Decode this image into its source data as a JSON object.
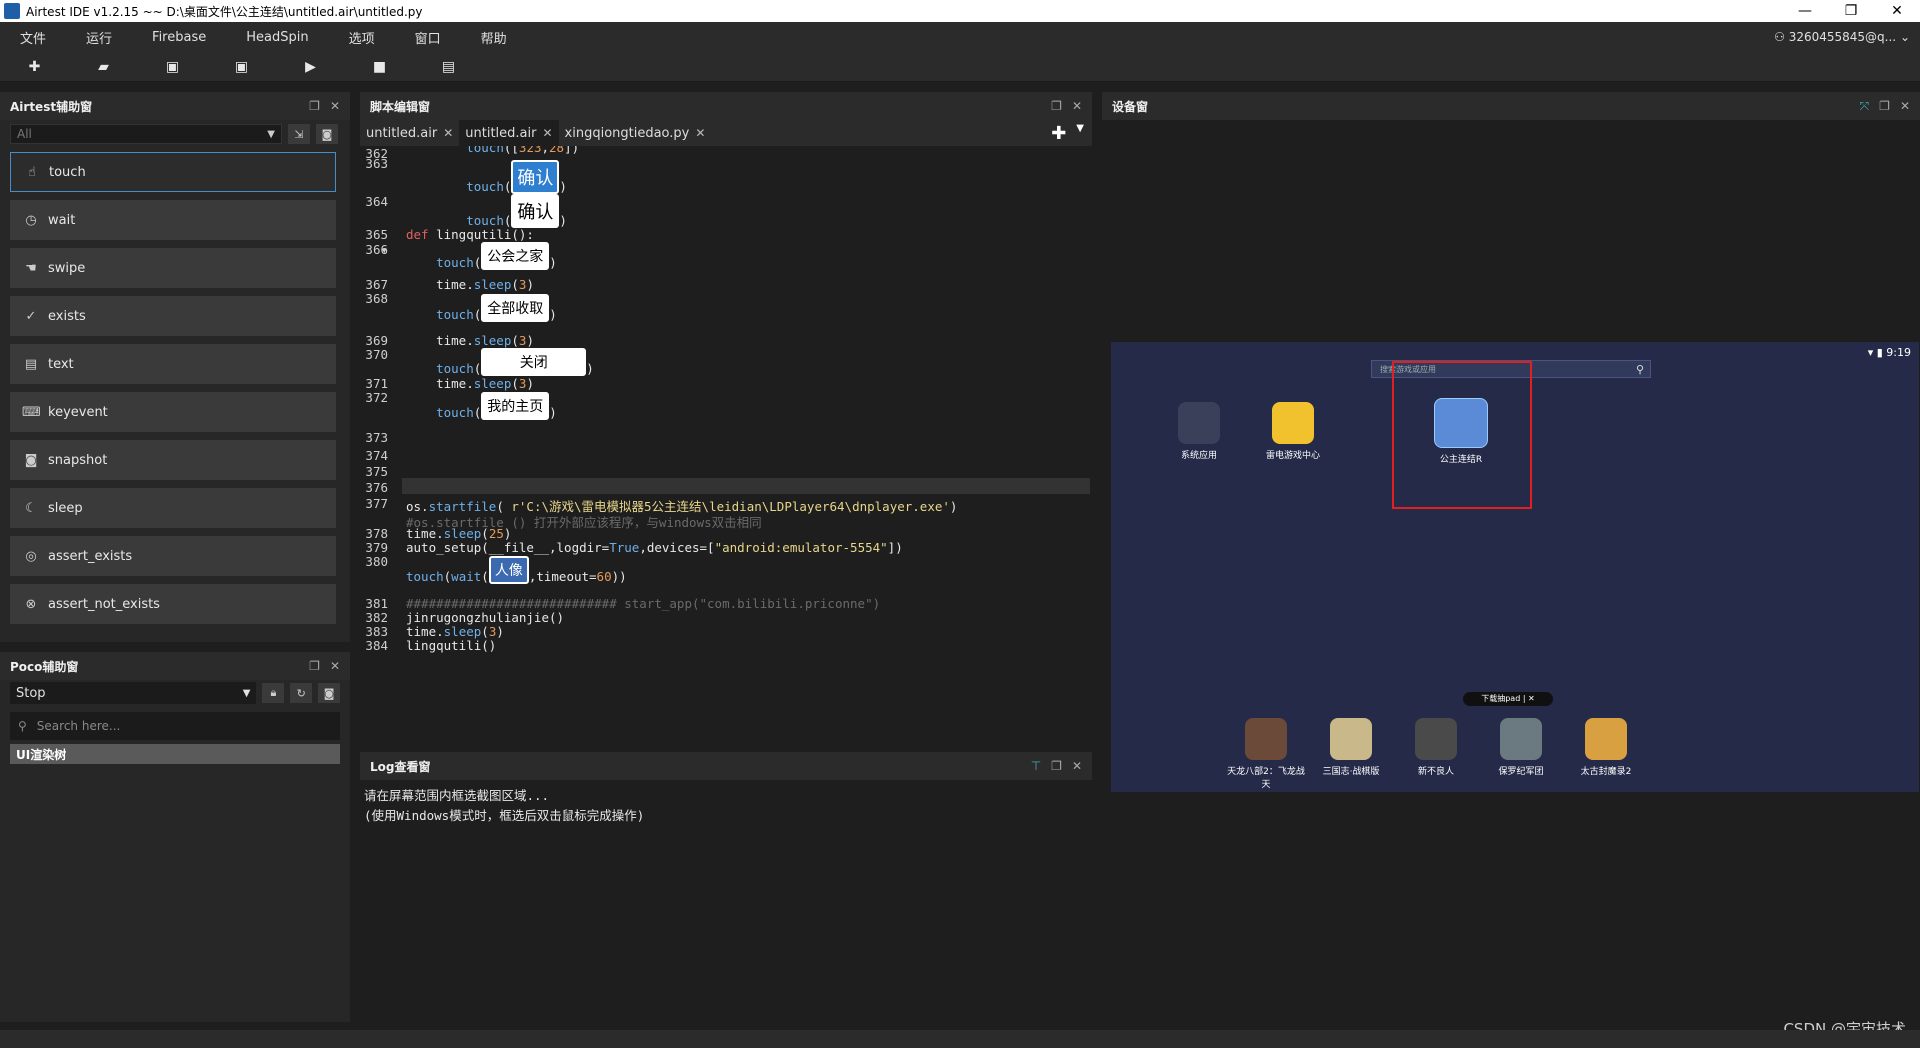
{
  "window": {
    "title": "Airtest IDE v1.2.15 ~~ D:\\桌面文件\\公主连结\\untitled.air\\untitled.py"
  },
  "menu": [
    "文件",
    "运行",
    "Firebase",
    "HeadSpin",
    "选项",
    "窗口",
    "帮助"
  ],
  "account": "3260455845@q...",
  "toolbar_icons": [
    "plus-icon",
    "folder-icon",
    "save-icon",
    "save-as-icon",
    "play-icon",
    "stop-icon",
    "log-icon"
  ],
  "airtest_panel": {
    "title": "Airtest辅助窗",
    "filter": "All",
    "items": [
      {
        "label": "touch",
        "icon": "☝"
      },
      {
        "label": "wait",
        "icon": "◷"
      },
      {
        "label": "swipe",
        "icon": "☚"
      },
      {
        "label": "exists",
        "icon": "✓"
      },
      {
        "label": "text",
        "icon": "▤"
      },
      {
        "label": "keyevent",
        "icon": "⌨"
      },
      {
        "label": "snapshot",
        "icon": "◙"
      },
      {
        "label": "sleep",
        "icon": "☾"
      },
      {
        "label": "assert_exists",
        "icon": "◎"
      },
      {
        "label": "assert_not_exists",
        "icon": "⊗"
      }
    ]
  },
  "poco_panel": {
    "title": "Poco辅助窗",
    "mode": "Stop",
    "search_placeholder": "Search here...",
    "tree_label": "UI渲染树"
  },
  "editor": {
    "title": "脚本编辑窗",
    "tabs": [
      {
        "label": "untitled.air",
        "active": false
      },
      {
        "label": "untitled.air",
        "active": true
      },
      {
        "label": "xingqiongtiedao.py",
        "active": false
      }
    ]
  },
  "log_panel": {
    "title": "Log查看窗",
    "lines": [
      "请在屏幕范围内框选截图区域...",
      "(使用Windows模式时，框选后双击鼠标完成操作)"
    ]
  },
  "device_panel": {
    "title": "设备窗",
    "time": "9:19",
    "search_placeholder": "搜索游戏或应用",
    "apps_top": [
      "系统应用",
      "雷电游戏中心",
      "公主连结R"
    ],
    "pad_chip": "下载抽pad  |  ✕",
    "apps_bottom": [
      "天龙八部2：飞龙战天",
      "三国志·战棋版",
      "新不良人",
      "保罗纪军团",
      "太古封魔录2"
    ]
  },
  "watermark": "CSDN @宇宙技术"
}
